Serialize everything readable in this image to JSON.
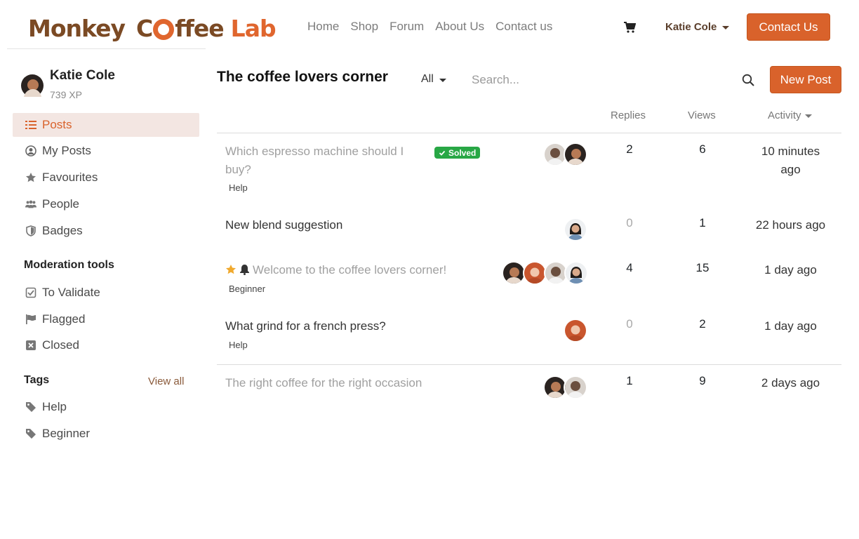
{
  "brand": {
    "part1": "Monkey",
    "part2a": "C",
    "part2b": "ffee",
    "part3": "Lab"
  },
  "nav": [
    "Home",
    "Shop",
    "Forum",
    "About Us",
    "Contact us"
  ],
  "user_menu": {
    "name": "Katie Cole"
  },
  "contact_button": "Contact Us",
  "profile": {
    "name": "Katie Cole",
    "xp": "739 XP"
  },
  "sidebar": {
    "items": [
      {
        "label": "Posts",
        "icon": "list-icon",
        "active": true
      },
      {
        "label": "My Posts",
        "icon": "user-circle-icon",
        "active": false
      },
      {
        "label": "Favourites",
        "icon": "star-icon",
        "active": false
      },
      {
        "label": "People",
        "icon": "users-icon",
        "active": false
      },
      {
        "label": "Badges",
        "icon": "shield-icon",
        "active": false
      }
    ],
    "moderation_heading": "Moderation tools",
    "moderation": [
      {
        "label": "To Validate",
        "icon": "check-square-icon"
      },
      {
        "label": "Flagged",
        "icon": "flag-icon"
      },
      {
        "label": "Closed",
        "icon": "x-square-icon"
      }
    ],
    "tags_heading": "Tags",
    "tags_view_all": "View all",
    "tags": [
      {
        "label": "Help",
        "icon": "tag-icon"
      },
      {
        "label": "Beginner",
        "icon": "tag-icon"
      }
    ]
  },
  "main": {
    "title": "The coffee lovers corner",
    "filter": "All",
    "search_placeholder": "Search...",
    "new_post": "New Post",
    "columns": {
      "replies": "Replies",
      "views": "Views",
      "activity": "Activity"
    },
    "posts": [
      {
        "title_line1": "Which espresso machine should I",
        "title_line2": "buy?",
        "solved": "Solved",
        "tag": "Help",
        "replies": "2",
        "views": "6",
        "activity_line1": "10 minutes",
        "activity_line2": "ago"
      },
      {
        "title": "New blend suggestion",
        "replies": "0",
        "views": "1",
        "activity": "22 hours ago"
      },
      {
        "title": "Welcome to the coffee lovers corner!",
        "tag": "Beginner",
        "replies": "4",
        "views": "15",
        "activity": "1 day ago"
      },
      {
        "title": "What grind for a french press?",
        "tag": "Help",
        "replies": "0",
        "views": "2",
        "activity": "1 day ago"
      },
      {
        "title": "The right coffee for the right occasion",
        "replies": "1",
        "views": "9",
        "activity": "2 days ago"
      }
    ]
  },
  "colors": {
    "accent": "#d9622b",
    "brand_brown": "#7b4a24",
    "solved_green": "#28a745",
    "active_bg": "#f3e6e2"
  }
}
